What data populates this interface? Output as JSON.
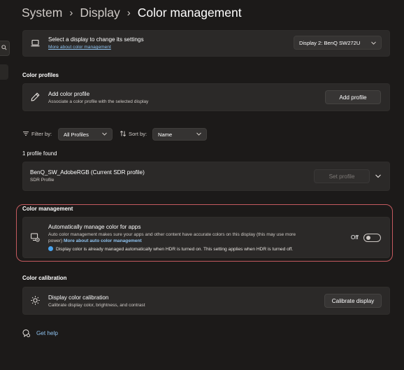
{
  "breadcrumb": {
    "items": [
      "System",
      "Display"
    ],
    "current": "Color management"
  },
  "display_select": {
    "title": "Select a display to change its settings",
    "link": "More about color management",
    "dropdown_value": "Display 2: BenQ SW272U"
  },
  "color_profiles": {
    "section_label": "Color profiles",
    "add_title": "Add color profile",
    "add_subtitle": "Associate a color profile with the selected display",
    "add_button": "Add profile"
  },
  "filters": {
    "filter_label": "Filter by:",
    "filter_value": "All Profiles",
    "sort_label": "Sort by:",
    "sort_value": "Name"
  },
  "profiles": {
    "count_text": "1 profile found",
    "items": [
      {
        "name": "BenQ_SW_AdobeRGB (Current SDR profile)",
        "type": "SDR Profile",
        "button": "Set profile"
      }
    ]
  },
  "color_management": {
    "section_label": "Color management",
    "title": "Automatically manage color for apps",
    "description_line1": "Auto color management makes sure your apps and other content have accurate colors on this display (this may use more",
    "description_line2": "power)",
    "link": "More about auto color management",
    "info": "Display color is already managed automatically when HDR is turned on. This setting applies when HDR is turned off.",
    "toggle_state": "Off",
    "toggle_on": false
  },
  "calibration": {
    "section_label": "Color calibration",
    "title": "Display color calibration",
    "subtitle": "Calibrate display color, brightness, and contrast",
    "button": "Calibrate display"
  },
  "help": {
    "label": "Get help"
  },
  "colors": {
    "background": "#1c1a19",
    "card": "#2b2928",
    "accent_link": "#8fc3f0",
    "info_blue": "#4aa4ee",
    "highlight_border": "#c45a5f"
  }
}
